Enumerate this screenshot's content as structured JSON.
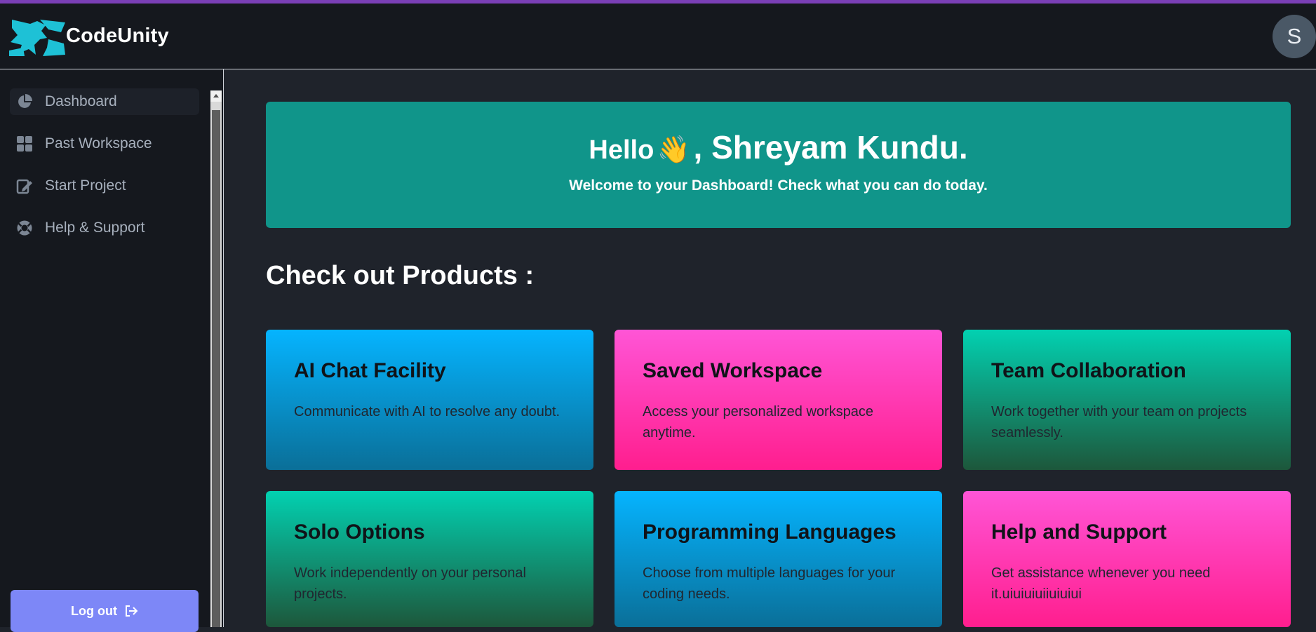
{
  "app": {
    "name": "CodeUnity"
  },
  "user": {
    "avatar_initial": "S"
  },
  "sidebar": {
    "items": [
      {
        "label": "Dashboard",
        "icon": "pie-chart-icon",
        "active": true
      },
      {
        "label": "Past Workspace",
        "icon": "grid-icon",
        "active": false
      },
      {
        "label": "Start Project",
        "icon": "edit-note-icon",
        "active": false
      },
      {
        "label": "Help & Support",
        "icon": "lifebuoy-icon",
        "active": false
      }
    ],
    "logout_label": "Log out",
    "logout_icon": "logout-icon"
  },
  "welcome": {
    "hello": "Hello",
    "wave_emoji": "👋",
    "name": ", Shreyam Kundu.",
    "subtitle": "Welcome to your Dashboard! Check what you can do today."
  },
  "products": {
    "title": "Check out Products :",
    "cards": [
      {
        "title": "AI Chat Facility",
        "description": "Communicate with AI to resolve any doubt."
      },
      {
        "title": "Saved Workspace",
        "description": "Access your personalized workspace anytime."
      },
      {
        "title": "Team Collaboration",
        "description": "Work together with your team on projects seamlessly."
      },
      {
        "title": "Solo Options",
        "description": "Work independently on your personal projects."
      },
      {
        "title": "Programming Languages",
        "description": "Choose from multiple languages for your coding needs."
      },
      {
        "title": "Help and Support",
        "description": "Get assistance whenever you need it.uiuiuiuiiuiuiui"
      }
    ]
  },
  "colors": {
    "accent_stripe": "#7a3fb6",
    "logo": "#1ec1d6",
    "welcome_banner": "#10958a",
    "logout_button": "#7d87f7",
    "card_blue": "#05b4ff",
    "card_pink": "#ff3fb4",
    "card_teal": "#02d1b1"
  }
}
